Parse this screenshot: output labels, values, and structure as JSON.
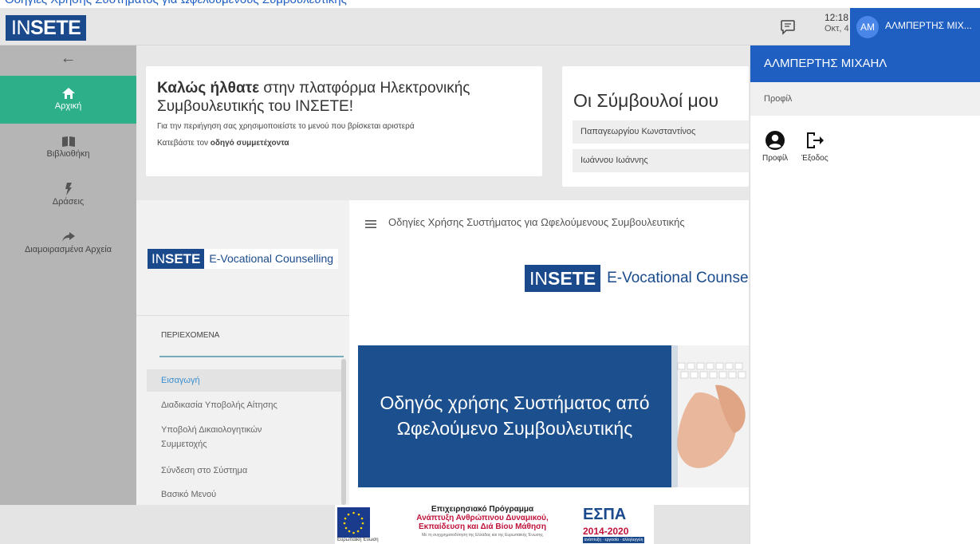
{
  "top_link": "Οδηγίες Χρήσης Συστήματος για Ωφελούμενους Συμβουλευτικής",
  "header": {
    "logo_thin": "IN",
    "logo_bold": "SETE",
    "time": "12:18",
    "date": "Οκτ, 4",
    "user_initials": "AM",
    "user_name": "ΑΛΜΠΕΡΤΗΣ ΜΙΧ..."
  },
  "sidebar": {
    "items": [
      {
        "label": "Αρχική",
        "icon": "home-icon"
      },
      {
        "label": "Βιβλιοθήκη",
        "icon": "book-icon"
      },
      {
        "label": "Δράσεις",
        "icon": "bolt-icon"
      },
      {
        "label": "Διαμοιρασμένα Αρχεία",
        "icon": "share-icon"
      }
    ]
  },
  "welcome": {
    "title_bold": "Καλώς ήλθατε",
    "title_rest": " στην πλατφόρμα Ηλεκτρονικής Συμβουλευτικής του ΙΝΣΕΤΕ!",
    "instructions": "Για την περιήγηση σας χρησιμοποιείστε το μενού που βρίσκεται αριστερά",
    "download_prefix": "Κατεβάστε τον ",
    "download_link": "οδηγό συμμετέχοντα"
  },
  "advisors": {
    "title": "Οι Σύμβουλοί μου",
    "list": [
      "Παπαγεωργίου Κωνσταντίνος",
      "Ιωάννου Ιωάννης"
    ]
  },
  "viewer": {
    "brand_thin": "IN",
    "brand_bold": "SETE",
    "brand_text": "E-Vocational Counselling",
    "brand_text_cropped": "E-Vocational Counse",
    "toc_title": "ΠΕΡΙΕΧΟΜΕΝΑ",
    "toc_items": [
      "Εισαγωγή",
      "Διαδικασία Υποβολής Αίτησης",
      "Υποβολή Δικαιολογητικών Συμμετοχής",
      "Σύνδεση στο Σύστημα",
      "Βασικό Μενού"
    ],
    "doc_title": "Οδηγίες Χρήσης Συστήματος για Ωφελούμενους Συμβουλευτικής",
    "cover_title": "Οδηγός χρήσης Συστήματος από Ωφελούμενο Συμβουλευτικής"
  },
  "footer": {
    "eu_caption": "Ευρωπαϊκή Ένωση",
    "program_line1": "Επιχειρησιακό Πρόγραμμα",
    "program_line2": "Ανάπτυξη Ανθρώπινου Δυναμικού,",
    "program_line3": "Εκπαίδευση και Διά Βίου Μάθηση",
    "program_small": "Με τη συγχρηματοδότηση της Ελλάδας και της Ευρωπαϊκής Ένωσης",
    "espa_title": "ΕΣΠΑ",
    "espa_years": "2014-2020",
    "espa_tag": "ανάπτυξη · εργασία · αλληλεγγύη"
  },
  "panel": {
    "name": "ΑΛΜΠΕΡΤΗΣ ΜΙΧΑΗΛ",
    "subtitle": "Προφίλ",
    "profile_label": "Προφίλ",
    "logout_label": "Έξοδος"
  },
  "colors": {
    "brand_blue": "#1a4a8c",
    "accent_blue": "#1f5fc2",
    "active_green": "#2db08a"
  }
}
